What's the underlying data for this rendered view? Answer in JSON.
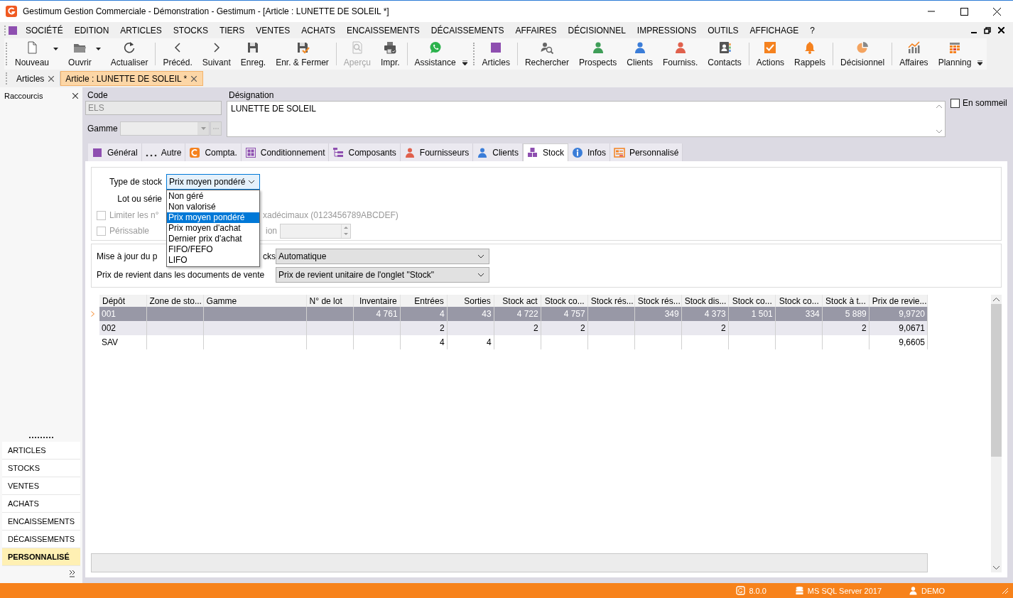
{
  "window": {
    "title": "Gestimum Gestion Commerciale - Démonstration - Gestimum - [Article : LUNETTE DE SOLEIL *]"
  },
  "menu": [
    "SOCIÉTÉ",
    "EDITION",
    "ARTICLES",
    "STOCKS",
    "TIERS",
    "VENTES",
    "ACHATS",
    "ENCAISSEMENTS",
    "DÉCAISSEMENTS",
    "AFFAIRES",
    "DÉCISIONNEL",
    "IMPRESSIONS",
    "OUTILS",
    "AFFICHAGE",
    "?"
  ],
  "toolbars": [
    {
      "groups": [
        {
          "items": [
            {
              "label": "Nouveau",
              "kind": "split",
              "disabled": false
            },
            {
              "label": "Ouvrir",
              "kind": "split",
              "disabled": false
            },
            {
              "label": "Actualiser",
              "kind": "button",
              "disabled": false
            }
          ]
        },
        {
          "items": [
            {
              "label": "Précéd.",
              "kind": "button",
              "disabled": false
            },
            {
              "label": "Suivant",
              "kind": "button",
              "disabled": false
            },
            {
              "label": "Enreg.",
              "kind": "button",
              "disabled": false
            },
            {
              "label": "Enr. & Fermer",
              "kind": "button",
              "disabled": false
            }
          ]
        },
        {
          "items": [
            {
              "label": "Aperçu",
              "kind": "button",
              "disabled": true
            },
            {
              "label": "Impr.",
              "kind": "button",
              "disabled": false
            }
          ]
        },
        {
          "items": [
            {
              "label": "Assistance",
              "kind": "button",
              "disabled": false
            }
          ]
        }
      ]
    },
    {
      "groups": [
        {
          "items": [
            {
              "label": "Articles",
              "kind": "button",
              "disabled": false
            }
          ]
        },
        {
          "items": [
            {
              "label": "Rechercher",
              "kind": "button",
              "disabled": false
            },
            {
              "label": "Prospects",
              "kind": "button",
              "disabled": false
            },
            {
              "label": "Clients",
              "kind": "button",
              "disabled": false
            },
            {
              "label": "Fourniss.",
              "kind": "button",
              "disabled": false
            },
            {
              "label": "Contacts",
              "kind": "button",
              "disabled": false
            }
          ]
        },
        {
          "items": [
            {
              "label": "Actions",
              "kind": "button",
              "disabled": false
            },
            {
              "label": "Rappels",
              "kind": "button",
              "disabled": false
            }
          ]
        },
        {
          "items": [
            {
              "label": "Décisionnel",
              "kind": "button",
              "disabled": false
            }
          ]
        },
        {
          "items": [
            {
              "label": "Affaires",
              "kind": "button",
              "disabled": false
            },
            {
              "label": "Planning",
              "kind": "button",
              "disabled": false
            }
          ]
        }
      ]
    }
  ],
  "document_tabs": [
    {
      "label": "Articles",
      "selected": false
    },
    {
      "label": "Article : LUNETTE DE SOLEIL *",
      "selected": true
    }
  ],
  "sidebar": {
    "title": "Raccourcis",
    "items": [
      {
        "label": "ARTICLES",
        "selected": false
      },
      {
        "label": "STOCKS",
        "selected": false
      },
      {
        "label": "VENTES",
        "selected": false
      },
      {
        "label": "ACHATS",
        "selected": false
      },
      {
        "label": "ENCAISSEMENTS",
        "selected": false
      },
      {
        "label": "DÉCAISSEMENTS",
        "selected": false
      },
      {
        "label": "PERSONNALISÉ",
        "selected": true
      }
    ]
  },
  "article": {
    "code": {
      "label": "Code",
      "value": "ELS",
      "disabled": true
    },
    "gamme": {
      "label": "Gamme",
      "disabled": true
    },
    "designation": {
      "label": "Désignation",
      "value": "LUNETTE DE SOLEIL"
    },
    "en_sommeil": {
      "label": "En sommeil",
      "checked": false
    }
  },
  "tabs": [
    {
      "label": "Général",
      "selected": false
    },
    {
      "label": "Autre",
      "selected": false
    },
    {
      "label": "Compta.",
      "selected": false
    },
    {
      "label": "Conditionnement",
      "selected": false
    },
    {
      "label": "Composants",
      "selected": false
    },
    {
      "label": "Fournisseurs",
      "selected": false
    },
    {
      "label": "Clients",
      "selected": false
    },
    {
      "label": "Stock",
      "selected": true
    },
    {
      "label": "Infos",
      "selected": false
    },
    {
      "label": "Personnalisé",
      "selected": false
    }
  ],
  "stock": {
    "type": {
      "label": "Type de stock",
      "value": "Prix moyen pondéré",
      "expanded": true,
      "options": [
        {
          "label": "Non géré",
          "selected": false
        },
        {
          "label": "Non valorisé",
          "selected": false
        },
        {
          "label": "Prix moyen pondéré",
          "selected": true
        },
        {
          "label": "Prix moyen d'achat",
          "selected": false
        },
        {
          "label": "Dernier prix d'achat",
          "selected": false
        },
        {
          "label": "FIFO/FEFO",
          "selected": false
        },
        {
          "label": "LIFO",
          "selected": false
        }
      ]
    },
    "lot_label": "Lot ou série",
    "limiter": {
      "label": "Limiter les n°",
      "tail": "xadécimaux (0123456789ABCDEF)",
      "checked": false,
      "disabled": true
    },
    "perissable": {
      "label": "Périssable",
      "tail": "ion",
      "checked": false,
      "disabled": true
    },
    "mise_a_jour": {
      "label": "Mise à jour du p",
      "tail": "cks",
      "value": "Automatique"
    },
    "prix_revient": {
      "label": "Prix de revient dans les documents de vente",
      "value": "Prix de revient unitaire de l'onglet \"Stock\""
    }
  },
  "grid": {
    "columns": [
      {
        "label": "Dépôt",
        "kind": "text"
      },
      {
        "label": "Zone de sto...",
        "kind": "text"
      },
      {
        "label": "Gamme",
        "kind": "text"
      },
      {
        "label": "N° de lot",
        "kind": "text"
      },
      {
        "label": "Inventaire",
        "kind": "number"
      },
      {
        "label": "Entrées",
        "kind": "number"
      },
      {
        "label": "Sorties",
        "kind": "number"
      },
      {
        "label": "Stock act",
        "kind": "number"
      },
      {
        "label": "Stock co...",
        "kind": "number"
      },
      {
        "label": "Stock rés...",
        "kind": "number"
      },
      {
        "label": "Stock rés...",
        "kind": "number"
      },
      {
        "label": "Stock dis...",
        "kind": "number"
      },
      {
        "label": "Stock co...",
        "kind": "number"
      },
      {
        "label": "Stock co...",
        "kind": "number"
      },
      {
        "label": "Stock à t...",
        "kind": "number"
      },
      {
        "label": "Prix de revie...",
        "kind": "number"
      }
    ],
    "rows": [
      {
        "selected": true,
        "cells": [
          "001",
          null,
          null,
          null,
          "4 761",
          "4",
          "43",
          "4 722",
          "4 757",
          null,
          "349",
          "4 373",
          "1 501",
          "334",
          "5 889",
          "9,9720"
        ]
      },
      {
        "selected": false,
        "cells": [
          "002",
          null,
          null,
          null,
          null,
          "2",
          null,
          "2",
          "2",
          null,
          null,
          "2",
          null,
          null,
          "2",
          "9,0671"
        ]
      },
      {
        "selected": false,
        "cells": [
          "SAV",
          null,
          null,
          null,
          null,
          "4",
          "4",
          null,
          null,
          null,
          null,
          null,
          null,
          null,
          null,
          "9,6605"
        ]
      }
    ]
  },
  "status_bar": {
    "version": "8.0.0",
    "server": "MS SQL Server 2017",
    "user": "DEMO"
  }
}
